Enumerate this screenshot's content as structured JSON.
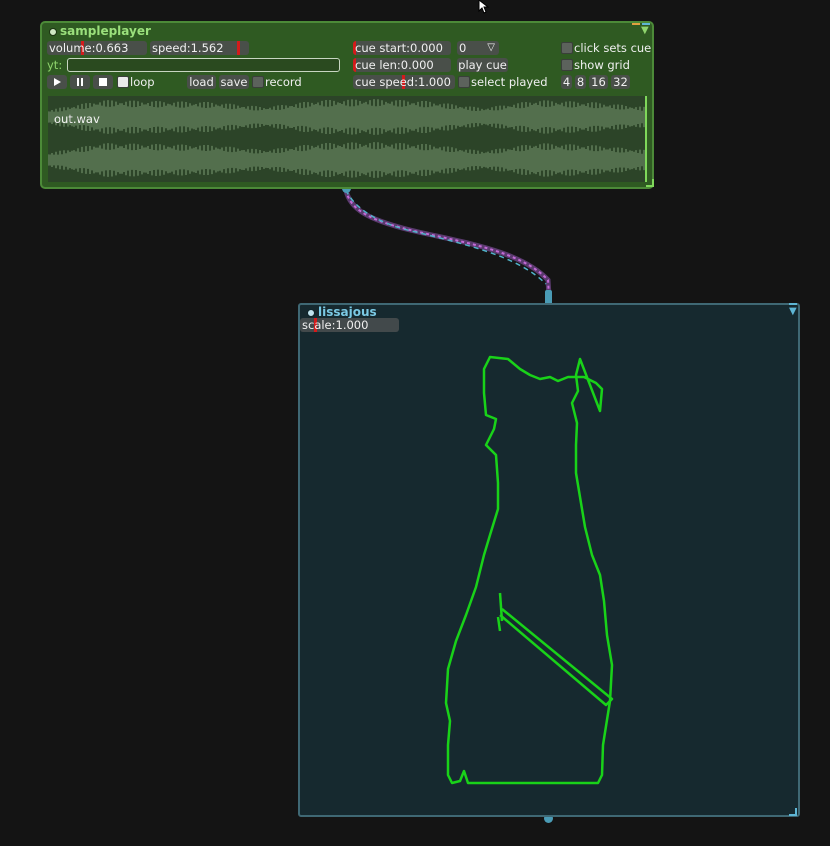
{
  "sampleplayer": {
    "title": "sampleplayer",
    "volume": {
      "label": "volume:0.663",
      "value": 0.663
    },
    "speed": {
      "label": "speed:1.562"
    },
    "yt_label": "yt:",
    "yt_value": "",
    "loop_label": "loop",
    "load_label": "load",
    "save_label": "save",
    "record_label": "record",
    "cue_start": {
      "label": "cue start:0.000"
    },
    "cue_len": {
      "label": "cue len:0.000"
    },
    "cue_speed": {
      "label": "cue speed:1.000"
    },
    "cue_select": {
      "value": "0"
    },
    "play_cue_label": "play cue",
    "click_sets_cue_label": "click sets cue",
    "show_grid_label": "show grid",
    "select_played_label": "select played",
    "grid_buttons": [
      "4",
      "8",
      "16",
      "32"
    ],
    "file_label": "out.wav"
  },
  "lissajous": {
    "title": "lissajous",
    "scale": {
      "label": "scale:1.000"
    }
  },
  "colors": {
    "sampleplayer_bg": "#2f5a22",
    "lissajous_bg": "#16292f",
    "trace": "#19d219",
    "slider_marker": "#d31b1b",
    "cable": "#8a4fb8"
  },
  "icons": {
    "transport": [
      "play-icon",
      "pause-icon",
      "stop-icon"
    ],
    "dropdown": "chevron-down-icon",
    "module_menu": "triangle-down-icon"
  }
}
